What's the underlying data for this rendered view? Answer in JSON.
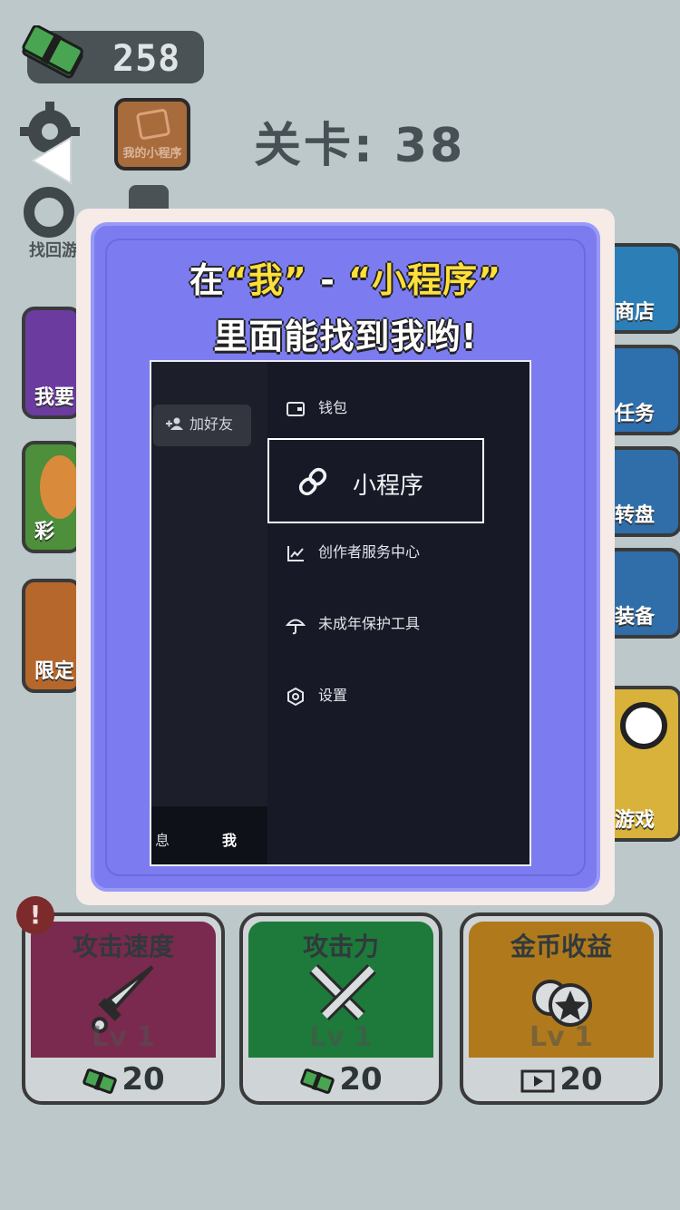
{
  "hud": {
    "coins": "258",
    "level_title": "关卡: 38",
    "mini_program_label": "我的小程序",
    "recover_label": "找回游",
    "colors": {
      "coin_green": "#3f9a4c",
      "panel_dark": "#4a5256"
    }
  },
  "left_side": [
    {
      "label": "我要",
      "color": "#6b3ba0"
    },
    {
      "label": "彩",
      "color": "#4d8f3a"
    },
    {
      "label": "限定",
      "color": "#b6672c"
    }
  ],
  "right_side": [
    {
      "label": "商店",
      "color": "#2b7fb6"
    },
    {
      "label": "任务",
      "color": "#2e6fae"
    },
    {
      "label": "转盘",
      "color": "#2f6ea8"
    },
    {
      "label": "装备",
      "color": "#2f6ea8"
    },
    {
      "label": "游戏",
      "color": "#d8b23a"
    }
  ],
  "upgrades": [
    {
      "name": "攻击速度",
      "level": "Lv 1",
      "cost": "20",
      "color": "#7a2a4e",
      "cost_icon": "cash-icon"
    },
    {
      "name": "攻击力",
      "level": "Lv 1",
      "cost": "20",
      "color": "#1d7a3a",
      "cost_icon": "cash-icon"
    },
    {
      "name": "金币收益",
      "level": "Lv 1",
      "cost": "20",
      "color": "#b07a1c",
      "cost_icon": "video-icon"
    }
  ],
  "alert_badge": "!",
  "modal": {
    "line1_prefix": "在",
    "line1_me": "“我”",
    "line1_dash": " - ",
    "line1_mini": "“小程序”",
    "line2": "里面能找到我哟!",
    "screenshot": {
      "add_friend": "加好友",
      "menu": {
        "wallet": "钱包",
        "mini_program": "小程序",
        "creator_center": "创作者服务中心",
        "minor_protection": "未成年保护工具",
        "settings": "设置"
      },
      "tabs": {
        "messages": "息",
        "me": "我"
      }
    }
  }
}
